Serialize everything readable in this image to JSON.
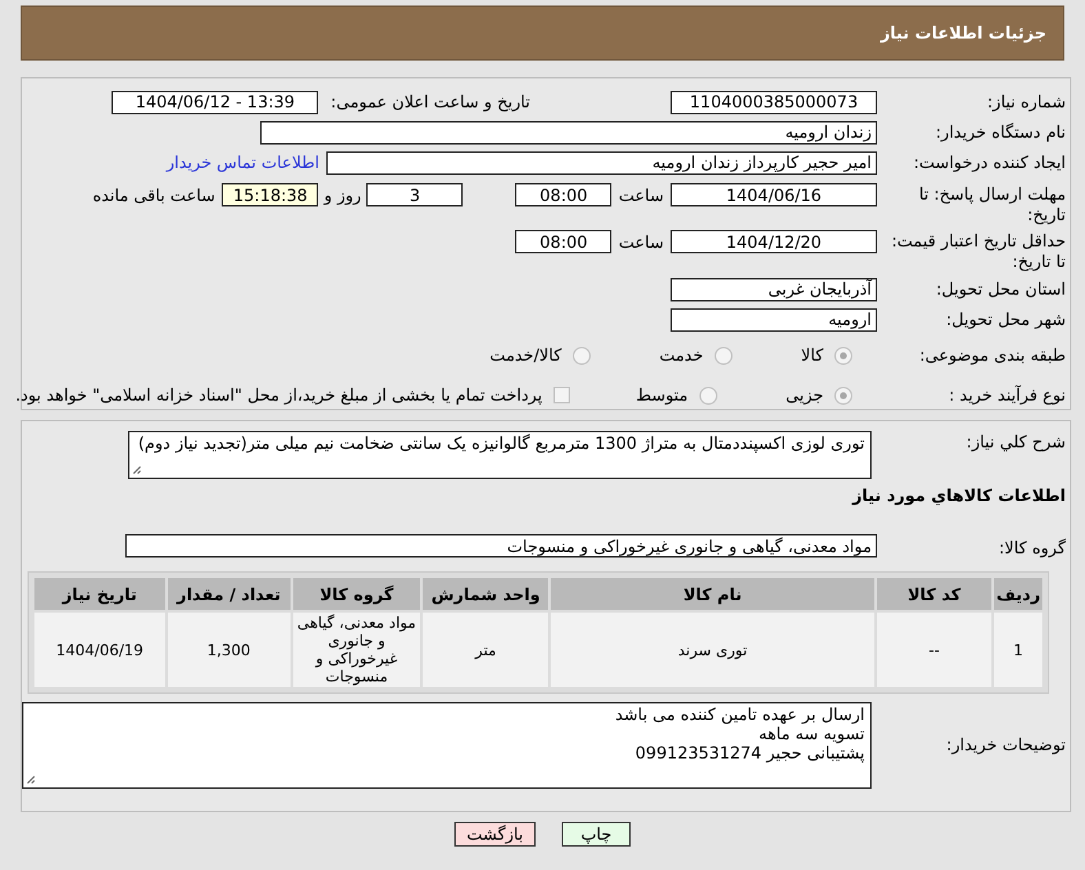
{
  "header": {
    "title": "جزئیات اطلاعات نیاز"
  },
  "details": {
    "need_number": {
      "label": "شماره نیاز:",
      "value": "1104000385000073"
    },
    "announce": {
      "label": "تاریخ و ساعت اعلان عمومی:",
      "value": "1404/06/12 - 13:39"
    },
    "buyer_org": {
      "label": "نام دستگاه خریدار:",
      "value": "زندان ارومیه"
    },
    "requester": {
      "label": "ایجاد کننده درخواست:",
      "value": "امیر حجیر کارپرداز زندان ارومیه",
      "link": "اطلاعات تماس خریدار"
    },
    "reply_deadline": {
      "label": "مهلت ارسال پاسخ: تا تاریخ:",
      "date": "1404/06/16",
      "time_label": "ساعت",
      "time": "08:00",
      "days": "3",
      "days_label": "روز و",
      "remaining": "15:18:38",
      "remaining_label": "ساعت باقی مانده"
    },
    "price_validity": {
      "label": "حداقل تاریخ اعتبار قیمت: تا تاریخ:",
      "date": "1404/12/20",
      "time_label": "ساعت",
      "time": "08:00"
    },
    "province": {
      "label": "استان محل تحویل:",
      "value": "آذربایجان غربی"
    },
    "city": {
      "label": "شهر محل تحویل:",
      "value": "ارومیه"
    },
    "category": {
      "label": "طبقه بندی موضوعی:",
      "options": [
        {
          "label": "کالا",
          "selected": true
        },
        {
          "label": "خدمت",
          "selected": false
        },
        {
          "label": "کالا/خدمت",
          "selected": false
        }
      ]
    },
    "process": {
      "label": "نوع فرآیند خرید :",
      "options": [
        {
          "label": "جزیی",
          "selected": true
        },
        {
          "label": "متوسط",
          "selected": false
        }
      ],
      "treasury": {
        "label": "پرداخت تمام یا بخشی از مبلغ خرید،از محل \"اسناد خزانه اسلامی\" خواهد بود.",
        "checked": false
      }
    }
  },
  "description": {
    "label": "شرح کلي نياز:",
    "value": "توری لوزی اکسپنددمتال به متراژ 1300 مترمربع گالوانیزه یک سانتی ضخامت نیم میلی متر(تجدید نیاز دوم)"
  },
  "goods": {
    "heading": "اطلاعات کالاهاي مورد نياز",
    "group_label": "گروه کالا:",
    "group": "مواد معدنی، گیاهی و جانوری غیرخوراکی و منسوجات",
    "table": {
      "columns": [
        "ردیف",
        "کد کالا",
        "نام کالا",
        "واحد شمارش",
        "گروه کالا",
        "تعداد / مقدار",
        "تاریخ نیاز"
      ],
      "rows": [
        [
          "1",
          "--",
          "توری سرند",
          "متر",
          "مواد معدنی، گیاهی و جانوری غیرخوراکی و منسوجات",
          "1,300",
          "1404/06/19"
        ]
      ]
    }
  },
  "buyer_notes": {
    "label": "توضیحات خریدار:",
    "lines": [
      "ارسال بر عهده تامین کننده می باشد",
      "تسویه سه ماهه",
      "پشتیبانی حجیر 099123531274"
    ]
  },
  "buttons": [
    {
      "label": "چاپ",
      "kind": "print"
    },
    {
      "label": "بازگشت",
      "kind": "back"
    }
  ]
}
